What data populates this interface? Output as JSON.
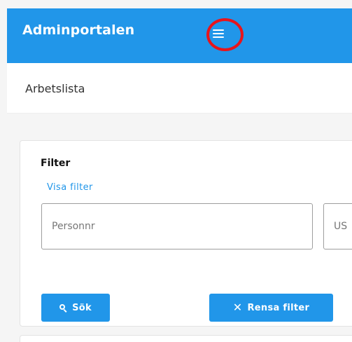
{
  "header": {
    "brand": "Adminportalen",
    "menu_icon": "hamburger-menu-icon",
    "background_color": "#2196e9",
    "highlight_color": "#e8141b"
  },
  "subheader": {
    "title": "Arbetslista"
  },
  "filter": {
    "heading": "Filter",
    "toggle_link": "Visa filter",
    "inputs": [
      {
        "placeholder": "Personnr",
        "value": ""
      },
      {
        "placeholder": "US",
        "value": ""
      }
    ],
    "search_button": {
      "label": "Sök",
      "icon": "search-icon"
    },
    "clear_button": {
      "label": "Rensa filter",
      "icon": "close-icon"
    }
  }
}
